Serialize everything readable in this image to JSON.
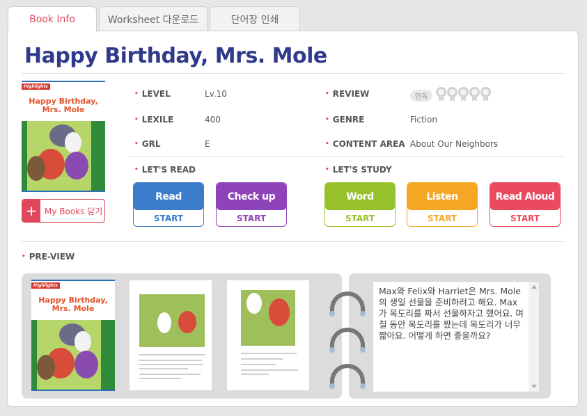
{
  "tabs": [
    {
      "label": "Book Info"
    },
    {
      "label": "Worksheet 다운로드"
    },
    {
      "label": "단어장 인쇄"
    }
  ],
  "book": {
    "title": "Happy Birthday, Mrs. Mole",
    "cover_brand": "Highlights",
    "cover_title_line1": "Happy Birthday,",
    "cover_title_line2": "Mrs. Mole"
  },
  "mybooks": {
    "label": "My Books 담기"
  },
  "info": {
    "level_label": "LEVEL",
    "level_value": "Lv.10",
    "lexile_label": "LEXILE",
    "lexile_value": "400",
    "grl_label": "GRL",
    "grl_value": "E",
    "review_label": "REVIEW",
    "review_badge": "안독",
    "review_rating": 0,
    "review_max": 5,
    "genre_label": "GENRE",
    "genre_value": "Fiction",
    "area_label": "CONTENT AREA",
    "area_value": "About Our Neighbors"
  },
  "lets_read": {
    "label": "LET'S READ",
    "buttons": [
      {
        "label": "Read",
        "start": "START",
        "color": "#3a7cc9"
      },
      {
        "label": "Check up",
        "start": "START",
        "color": "#8e44b8"
      }
    ]
  },
  "lets_study": {
    "label": "LET'S STUDY",
    "buttons": [
      {
        "label": "Word",
        "start": "START",
        "color": "#97c12a"
      },
      {
        "label": "Listen",
        "start": "START",
        "color": "#f5a623"
      },
      {
        "label": "Read Aloud",
        "start": "START",
        "color": "#e94a5e"
      }
    ]
  },
  "preview": {
    "label": "PRE-VIEW",
    "summary": "Max와 Felix와 Harriet은 Mrs. Mole의 생일 선물을 준비하려고 해요. Max가 목도리를 짜서 선물하자고 했어요. 며칠 동안 목도리를 짰는데 목도리가 너무 짧아요. 어떻게 하면 좋을까요?"
  }
}
